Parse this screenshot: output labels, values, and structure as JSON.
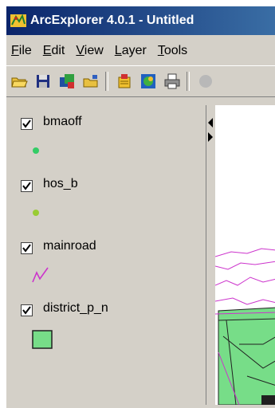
{
  "window": {
    "title": "ArcExplorer 4.0.1 - Untitled"
  },
  "menu": [
    {
      "underline": "F",
      "rest": "ile"
    },
    {
      "underline": "E",
      "rest": "dit"
    },
    {
      "underline": "V",
      "rest": "iew"
    },
    {
      "underline": "L",
      "rest": "ayer"
    },
    {
      "underline": "T",
      "rest": "ools"
    }
  ],
  "toolbar": {
    "icons": [
      "open-folder-icon",
      "save-disk-icon",
      "add-layer-icon",
      "open-folder-icon",
      "layer-properties-icon",
      "map-globe-icon",
      "print-icon"
    ]
  },
  "layers": [
    {
      "name": "bmaoff",
      "checked": true,
      "symbol": "point",
      "color": "#33cc66"
    },
    {
      "name": "hos_b",
      "checked": true,
      "symbol": "point",
      "color": "#99cc33"
    },
    {
      "name": "mainroad",
      "checked": true,
      "symbol": "line",
      "color": "#cc33cc"
    },
    {
      "name": "district_p_n",
      "checked": true,
      "symbol": "polygon",
      "color": "#77dd88"
    }
  ],
  "colors": {
    "title_gradient_start": "#0a246a",
    "title_gradient_end": "#3a6ea5",
    "face": "#d4d0c8",
    "road": "#cc33cc",
    "district_fill": "#77dd88"
  }
}
